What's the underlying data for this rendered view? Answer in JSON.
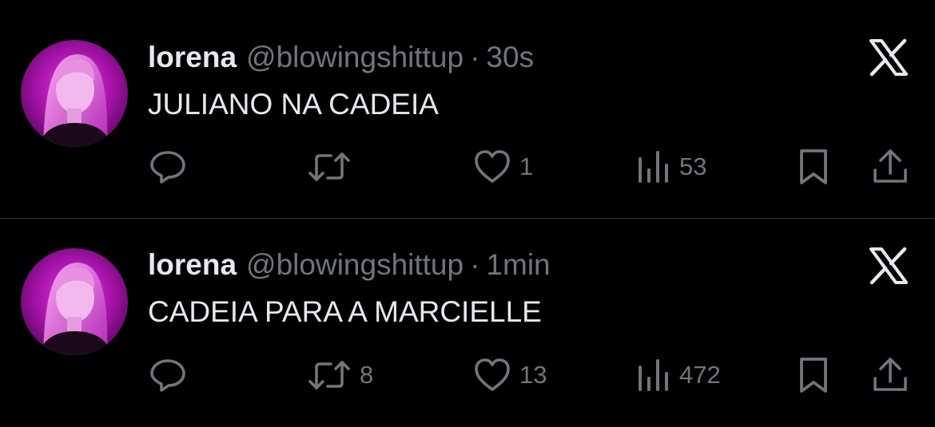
{
  "tweets": [
    {
      "author_name": "lorena",
      "handle": "@blowingshittup",
      "separator": "·",
      "time": "30s",
      "text": "JULIANO NA CADEIA",
      "reply_count": "",
      "retweet_count": "",
      "like_count": "1",
      "view_count": "53"
    },
    {
      "author_name": "lorena",
      "handle": "@blowingshittup",
      "separator": "·",
      "time": "1min",
      "text": "CADEIA PARA A MARCIELLE",
      "reply_count": "",
      "retweet_count": "8",
      "like_count": "13",
      "view_count": "472"
    }
  ],
  "icons": {
    "platform": "x-logo-icon",
    "reply": "reply-icon",
    "retweet": "retweet-icon",
    "like": "heart-icon",
    "views": "views-icon",
    "bookmark": "bookmark-icon",
    "share": "share-icon"
  },
  "colors": {
    "background": "#000000",
    "text": "#e7e9ea",
    "secondary": "#71767b",
    "divider": "#2f3336",
    "avatar_tint": "#c21fc4"
  }
}
